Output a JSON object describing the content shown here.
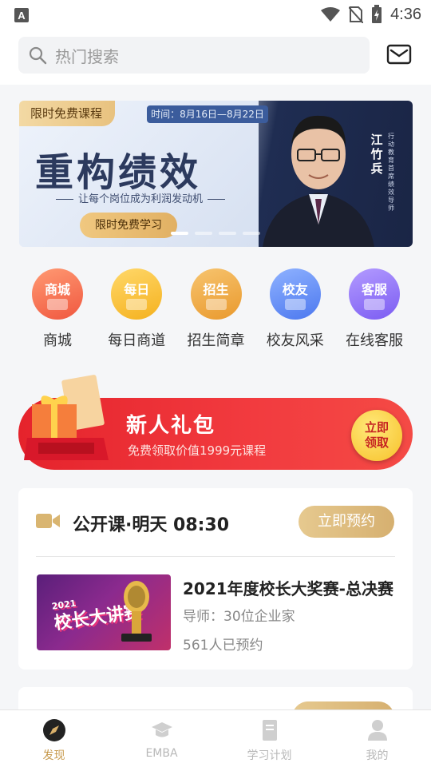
{
  "status_bar": {
    "app_badge": "A",
    "time": "4:36"
  },
  "search": {
    "placeholder": "热门搜索"
  },
  "banner": {
    "tag": "限时免费课程",
    "time": "时间：8月16日—8月22日",
    "title": "重构绩效",
    "subtitle": "让每个岗位成为利润发动机",
    "button": "限时免费学习",
    "name": "江竹兵",
    "role": "行动教育首席绩效导师",
    "active_slide": 1,
    "slide_count": 4
  },
  "quick_nav": [
    {
      "icon_text": "商城",
      "label": "商城",
      "color_from": "#ff9a73",
      "color_to": "#f0573f"
    },
    {
      "icon_text": "每日",
      "label": "每日商道",
      "color_from": "#ffd86a",
      "color_to": "#f5b11e"
    },
    {
      "icon_text": "招生",
      "label": "招生简章",
      "color_from": "#f7c46f",
      "color_to": "#e9992d"
    },
    {
      "icon_text": "校友",
      "label": "校友风采",
      "color_from": "#8fb2ff",
      "color_to": "#4c78ef"
    },
    {
      "icon_text": "客服",
      "label": "在线客服",
      "color_from": "#b39bff",
      "color_to": "#7b5cf2"
    }
  ],
  "promo": {
    "title": "新人礼包",
    "subtitle": "免费领取价值1999元课程",
    "button": "立即领取"
  },
  "course_card": {
    "title": "公开课·明天 08:30",
    "reserve_button": "立即预约",
    "thumb_year": "2021",
    "thumb_title": "校长大讲赛",
    "course_name": "2021年度校长大奖赛-总决赛",
    "teacher": "导师：30位企业家",
    "count": "561人已预约"
  },
  "tabs": [
    {
      "label": "发现",
      "icon": "compass-icon",
      "active": true
    },
    {
      "label": "EMBA",
      "icon": "graduation-cap-icon",
      "active": false
    },
    {
      "label": "学习计划",
      "icon": "document-icon",
      "active": false
    },
    {
      "label": "我的",
      "icon": "person-icon",
      "active": false
    }
  ],
  "colors": {
    "accent": "#c79a4d",
    "promo_red": "#e5232c"
  }
}
